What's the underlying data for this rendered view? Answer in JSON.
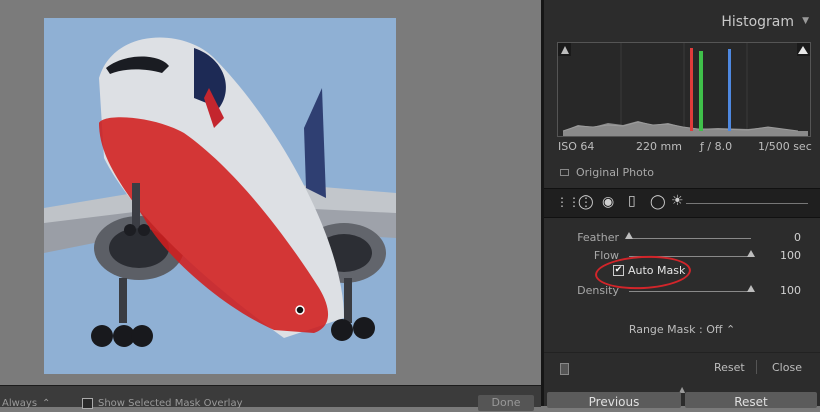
{
  "histogram": {
    "title": "Histogram",
    "iso": "ISO 64",
    "focal_length": "220 mm",
    "aperture": "ƒ / 8.0",
    "shutter": "1/500 sec",
    "original_photo_label": "Original Photo"
  },
  "brush": {
    "feather_label": "Feather",
    "feather_value": "0",
    "feather_level": 0.0,
    "flow_label": "Flow",
    "flow_value": "100",
    "flow_level": 1.0,
    "auto_mask_label": "Auto Mask",
    "auto_mask_checked": true,
    "density_label": "Density",
    "density_value": "100",
    "density_level": 1.0
  },
  "range_mask": {
    "label": "Range Mask :",
    "value": "Off"
  },
  "panel_footer": {
    "reset": "Reset",
    "close": "Close"
  },
  "bottom_buttons": {
    "previous": "Previous",
    "reset": "Reset"
  },
  "toolbar": {
    "always_label": "Always",
    "show_overlay_label": "Show Selected Mask Overlay",
    "done_label": "Done"
  },
  "colors": {
    "mask_overlay": "#d21e1e",
    "annotation_ring": "#d2252a",
    "sky": "#8fb0d4"
  }
}
